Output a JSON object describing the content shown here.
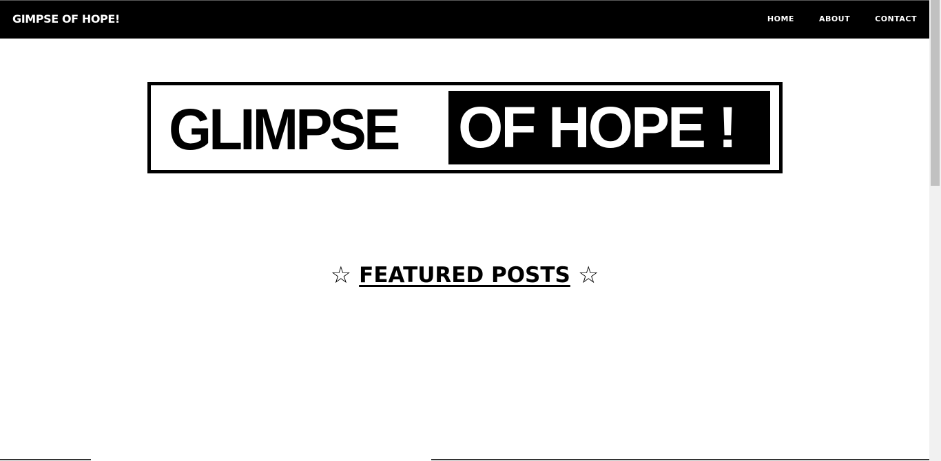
{
  "navbar": {
    "brand": "GIMPSE OF HOPE!",
    "links": [
      {
        "label": "HOME"
      },
      {
        "label": "ABOUT"
      },
      {
        "label": "CONTACT"
      }
    ]
  },
  "logo": {
    "text_left": "GLIMPSE",
    "text_right": "OF HOPE !"
  },
  "featured": {
    "star": "☆",
    "title": "FEATURED POSTS"
  },
  "colors": {
    "navbar_bg": "#000000",
    "text": "#000000",
    "background": "#ffffff"
  }
}
